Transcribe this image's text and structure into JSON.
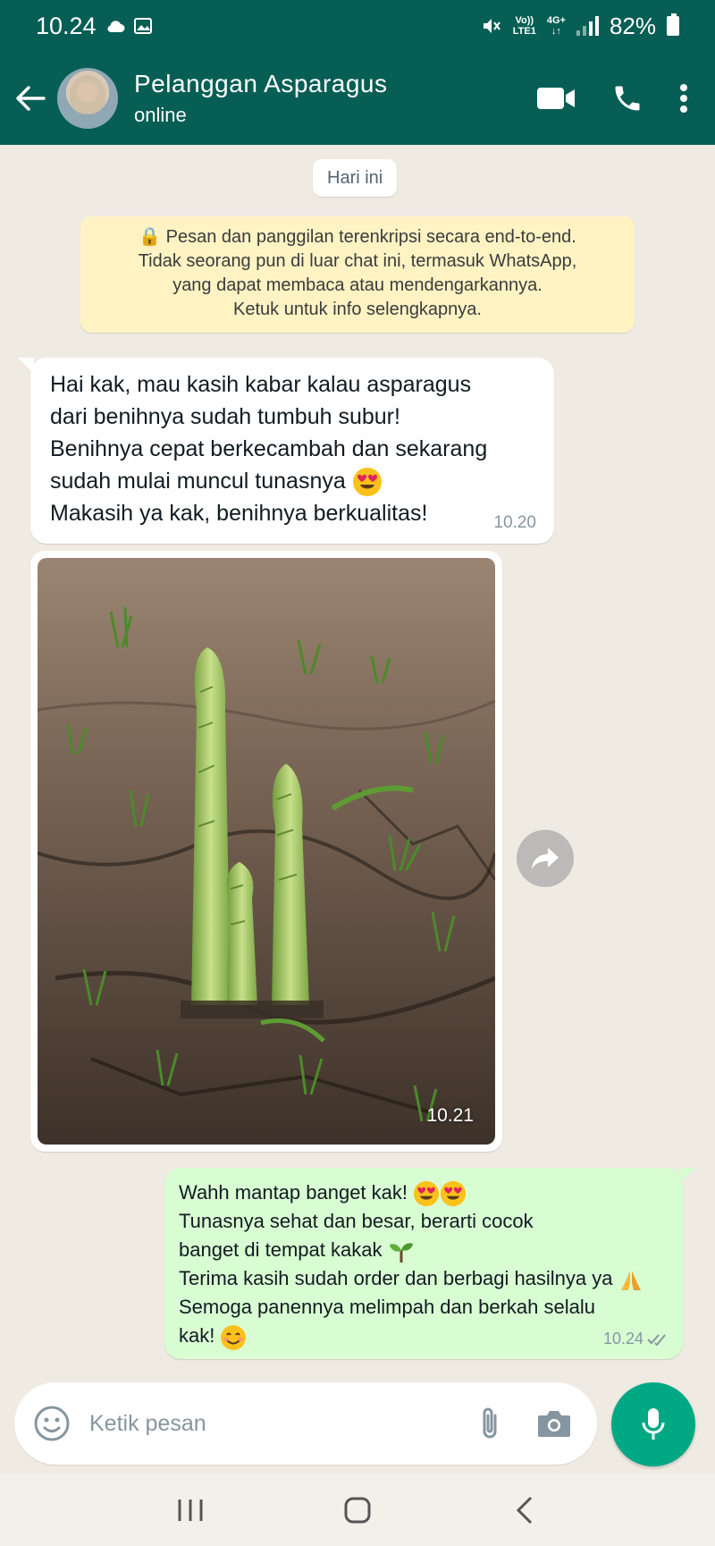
{
  "status_bar": {
    "time": "10.24",
    "network_top": "Vo))",
    "network_bottom": "LTE1",
    "data_top": "4G+",
    "data_bottom": "↓↑",
    "battery": "82%"
  },
  "header": {
    "contact_name": "Pelanggan Asparagus",
    "contact_status": "online"
  },
  "chat": {
    "date_chip": "Hari ini",
    "encryption_notice": [
      "🔒 Pesan dan panggilan terenkripsi secara end-to-end.",
      "Tidak seorang pun di luar chat ini, termasuk WhatsApp,",
      "yang dapat membaca atau mendengarkannya.",
      "Ketuk untuk info selengkapnya."
    ],
    "incoming_message": {
      "lines": [
        "Hai kak, mau kasih kabar kalau asparagus",
        "dari benihnya sudah tumbuh subur!",
        "Benihnya cepat berkecambah dan sekarang",
        "sudah mulai muncul tunasnya",
        "Makasih ya kak, benihnya berkualitas!"
      ],
      "emoji": "heart-eyes",
      "time": "10.20"
    },
    "image_message": {
      "time": "10.21"
    },
    "outgoing_message": {
      "lines": [
        "Wahh mantap banget kak!",
        "Tunasnya sehat dan besar, berarti cocok",
        "banget di tempat kakak",
        "Terima kasih sudah order dan berbagi hasilnya ya",
        "Semoga panennya melimpah dan berkah selalu",
        "kak!"
      ],
      "time": "10.24",
      "read_status": "read"
    }
  },
  "input": {
    "placeholder": "Ketik pesan"
  },
  "colors": {
    "header": "#075e54",
    "chat_bg": "#efeae2",
    "incoming": "#ffffff",
    "outgoing": "#d9fdd3",
    "accent": "#00a884",
    "notice": "#fff3c4"
  }
}
